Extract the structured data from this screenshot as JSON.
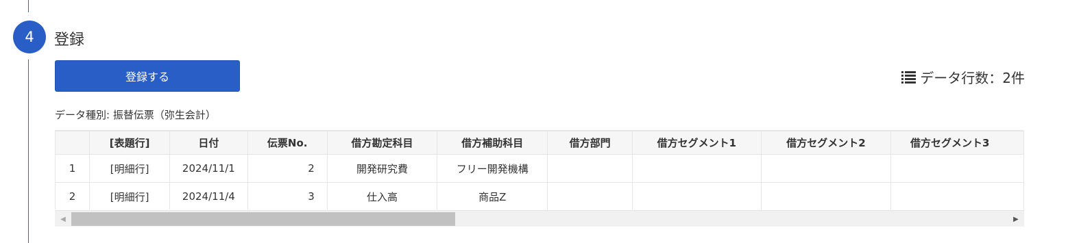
{
  "step": {
    "number": "4",
    "title": "登録"
  },
  "register_button": {
    "label": "登録する"
  },
  "row_count": {
    "icon": "list-icon",
    "text": "データ行数：2件"
  },
  "data_type": {
    "text": "データ種別: 振替伝票（弥生会計）"
  },
  "table": {
    "headers": [
      "",
      "[表題行]",
      "日付",
      "伝票No.",
      "借方勘定科目",
      "借方補助科目",
      "借方部門",
      "借方セグメント1",
      "借方セグメント2",
      "借方セグメント3"
    ],
    "rows": [
      [
        "1",
        "[明細行]",
        "2024/11/1",
        "2",
        "開発研究費",
        "フリー開発機構",
        "",
        "",
        "",
        ""
      ],
      [
        "2",
        "[明細行]",
        "2024/11/4",
        "3",
        "仕入高",
        "商品Z",
        "",
        "",
        "",
        ""
      ]
    ]
  },
  "colors": {
    "primary": "#2a5ec7",
    "step_line": "#2e7d6b"
  }
}
